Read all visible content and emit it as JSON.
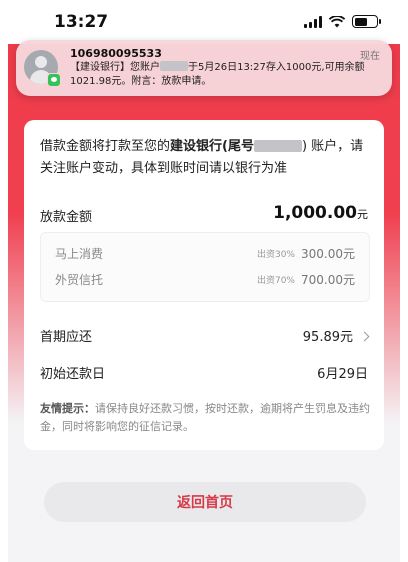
{
  "status_bar": {
    "time": "13:27"
  },
  "notification": {
    "sender": "106980095533",
    "time": "现在",
    "body_prefix": "【建设银行】您账户",
    "body_suffix": "于5月26日13:27存入1000元,可用余额1021.98元。附言：放款申请。"
  },
  "card": {
    "intro_prefix": "借款金额将打款至您的",
    "bank_name": "建设银行(尾号",
    "intro_suffix": ") 账户，请关注账户变动，具体到账时间请以银行为准",
    "loan_amount_label": "放款金额",
    "loan_amount_value": "1,000.00",
    "loan_amount_unit": "元",
    "funders": [
      {
        "name": "马上消费",
        "share": "出资30%",
        "amount": "300.00元"
      },
      {
        "name": "外贸信托",
        "share": "出资70%",
        "amount": "700.00元"
      }
    ],
    "first_repay_label": "首期应还",
    "first_repay_value": "95.89元",
    "initial_date_label": "初始还款日",
    "initial_date_value": "6月29日",
    "tip_title": "友情提示：",
    "tip_text": "请保持良好还款习惯，按时还款，逾期将产生罚息及违约金，同时将影响您的征信记录。"
  },
  "footer": {
    "back_home_label": "返回首页"
  },
  "colors": {
    "accent": "#ee3b4a",
    "button_text": "#d63a48"
  }
}
